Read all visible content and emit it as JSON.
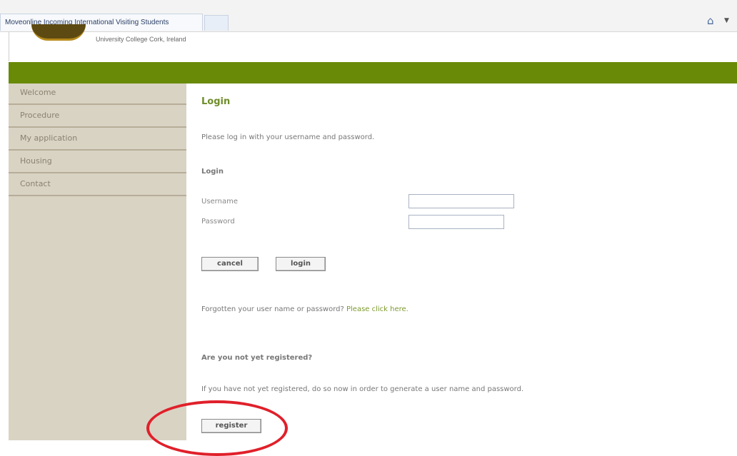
{
  "browser": {
    "tab_title": "Moveonline Incoming International Visiting Students",
    "toolbar_icon": "home-icon"
  },
  "header": {
    "institution": "University College Cork, Ireland",
    "accent_color": "#688a07"
  },
  "sidebar": {
    "items": [
      {
        "label": "Welcome"
      },
      {
        "label": "Procedure"
      },
      {
        "label": "My application"
      },
      {
        "label": "Housing"
      },
      {
        "label": "Contact"
      }
    ]
  },
  "main": {
    "title": "Login",
    "intro": "Please log in with your username and password.",
    "form_heading": "Login",
    "username_label": "Username",
    "username_value": "",
    "password_label": "Password",
    "password_value": "",
    "cancel_label": "cancel",
    "login_label": "login",
    "forgot_text": "Forgotten your user name or password?",
    "forgot_link": "Please click here.",
    "register_question": "Are you not yet registered?",
    "register_text": "If you have not yet registered, do so now in order to generate a user name and password.",
    "register_label": "register"
  },
  "annotation": {
    "highlight_color": "#e0202a"
  }
}
